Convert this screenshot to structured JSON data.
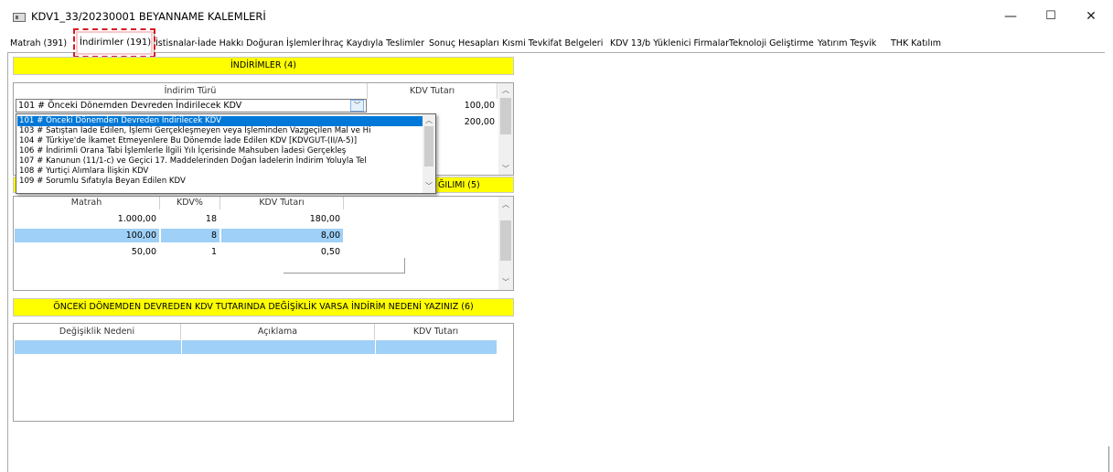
{
  "window": {
    "title": "KDV1_33/20230001 BEYANNAME KALEMLERİ",
    "minimize": "—",
    "maximize": "☐",
    "close": "✕"
  },
  "tabs": [
    {
      "label": "Matrah (391)"
    },
    {
      "label": "İndirimler (191)"
    },
    {
      "label": "İstisnalar-İade Hakkı Doğuran İşlemler"
    },
    {
      "label": "İhraç Kaydıyla Teslimler"
    },
    {
      "label": "Sonuç Hesapları"
    },
    {
      "label": "Kısmi Tevkifat Belgeleri"
    },
    {
      "label": "KDV 13/b Yüklenici Firmalar"
    },
    {
      "label": "Teknoloji Geliştirme"
    },
    {
      "label": "Yatırım Teşvik"
    },
    {
      "label": "THK Katılım"
    }
  ],
  "indirimler": {
    "band": "İNDİRİMLER (4)",
    "col_type": "İndirim Türü",
    "col_amount": "KDV Tutarı",
    "rows": [
      {
        "type": "101 # Önceki Dönemden Devreden İndirilecek KDV",
        "amount": "100,00"
      },
      {
        "type": "",
        "amount": "200,00"
      }
    ]
  },
  "dropdown": {
    "items": [
      "101 # Önceki Dönemden Devreden İndirilecek KDV",
      "103 # Satıştan İade Edilen, İşlemi Gerçekleşmeyen veya İşleminden Vazgeçilen Mal ve Hi",
      "104 # Türkiye'de İkamet Etmeyenlere Bu Dönemde İade Edilen KDV [KDVGUT-(II/A-5)]",
      "106 # İndirimli Orana Tabi İşlemlerle İlgili Yılı İçerisinde Mahsuben İadesi Gerçekleş",
      "107 # Kanunun (11/1-c) ve Geçici 17. Maddelerinden Doğan İadelerin İndirim Yoluyla Tel",
      "108 # Yurtiçi Alımlara İlişkin KDV",
      "109 # Sorumlu Sıfatıyla Beyan Edilen KDV"
    ],
    "selected_index": 0
  },
  "dagilim": {
    "band_fragment": "ĞILIMI (5)",
    "col_matrah": "Matrah",
    "col_rate": "KDV%",
    "col_amount": "KDV Tutarı",
    "rows": [
      {
        "matrah": "1.000,00",
        "rate": "18",
        "amount": "180,00"
      },
      {
        "matrah": "100,00",
        "rate": "8",
        "amount": "8,00"
      },
      {
        "matrah": "50,00",
        "rate": "1",
        "amount": "0,50"
      }
    ],
    "selected_row": 1
  },
  "degisiklik": {
    "band": "ÖNCEKİ DÖNEMDEN DEVREDEN KDV TUTARINDA DEĞİŞİKLİK VARSA İNDİRİM  NEDENİ YAZINIZ (6)",
    "col_reason": "Değişiklik Nedeni",
    "col_desc": "Açıklama",
    "col_amount": "KDV Tutarı"
  },
  "colors": {
    "band_yellow": "#ffff00",
    "selection_blue": "#0078d7",
    "row_highlight": "#9fd0f7",
    "tab_highlight_border": "#d81b23"
  }
}
